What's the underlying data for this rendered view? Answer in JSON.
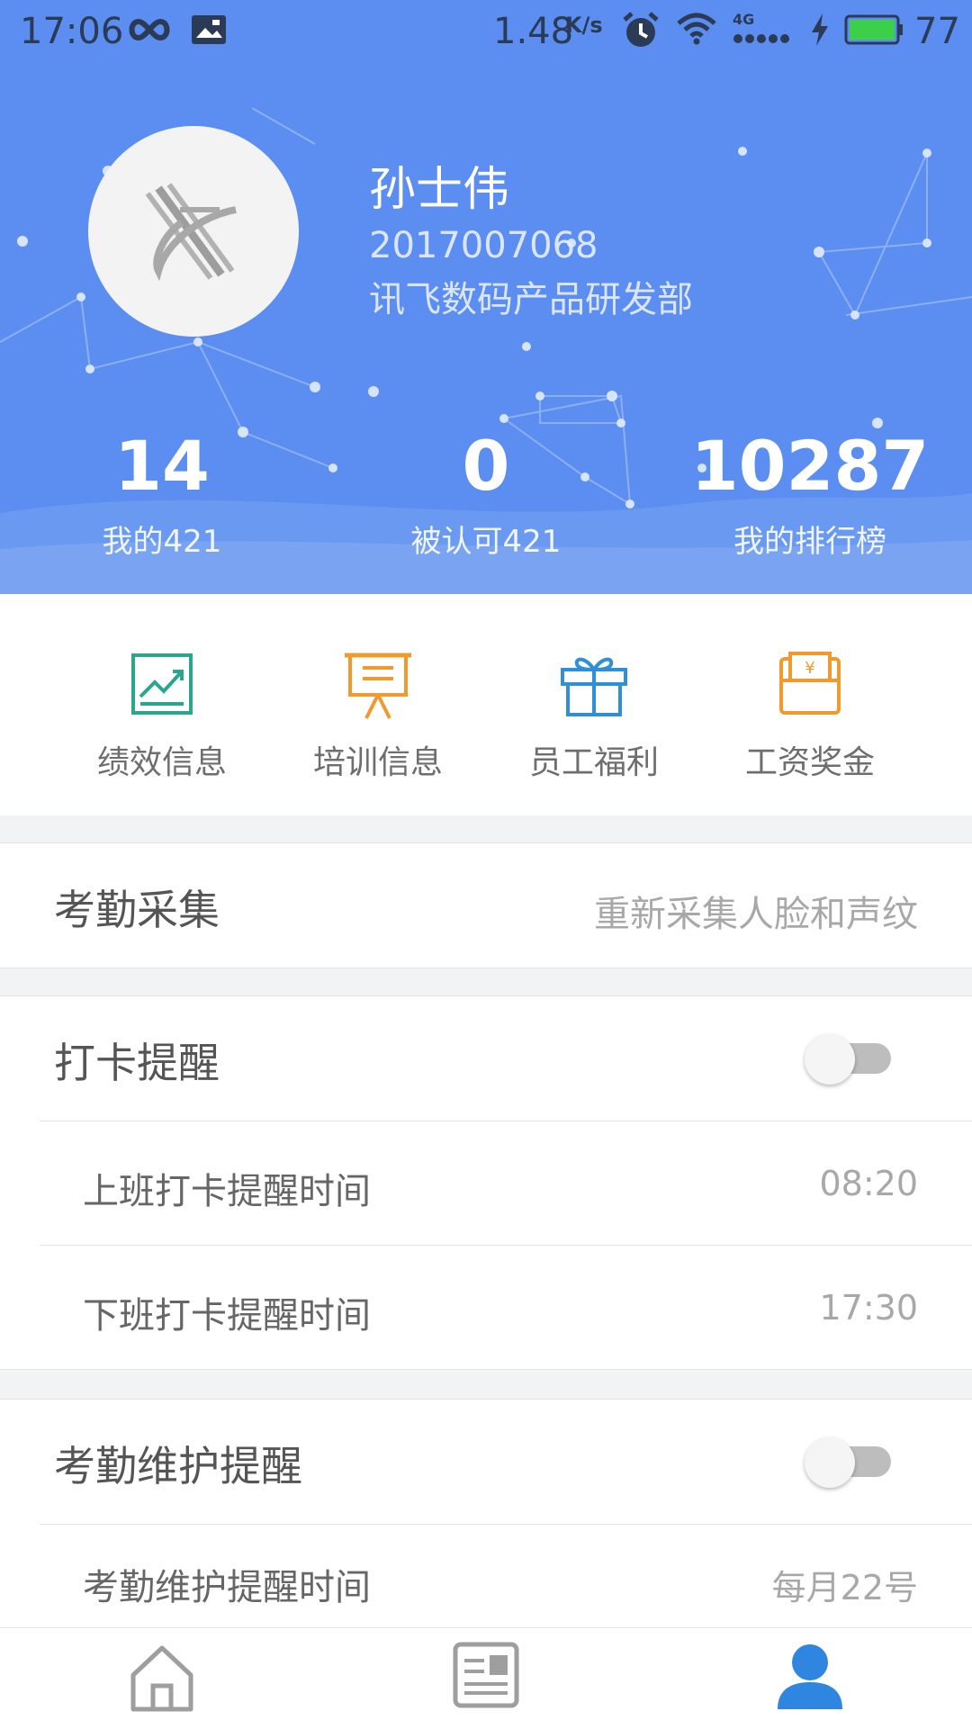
{
  "status_bar": {
    "time": "17:06",
    "network_speed": "1.48",
    "speed_unit": "K/s",
    "network_type": "4G",
    "battery": "77",
    "icons": [
      "infinity-icon",
      "image-icon",
      "alarm-icon",
      "wifi-icon",
      "signal-icon",
      "charging-icon",
      "battery-icon"
    ]
  },
  "profile": {
    "name": "孙士伟",
    "employee_id": "2017007068",
    "department": "讯飞数码产品研发部"
  },
  "stats": [
    {
      "value": "14",
      "label": "我的421"
    },
    {
      "value": "0",
      "label": "被认可421"
    },
    {
      "value": "10287",
      "label": "我的排行榜"
    }
  ],
  "quick_menu": [
    {
      "label": "绩效信息",
      "icon": "chart-icon",
      "color": "#2aa68f"
    },
    {
      "label": "培训信息",
      "icon": "presentation-icon",
      "color": "#f2992e"
    },
    {
      "label": "员工福利",
      "icon": "gift-icon",
      "color": "#2f8fd8"
    },
    {
      "label": "工资奖金",
      "icon": "wallet-icon",
      "color": "#f2992e"
    }
  ],
  "attendance_capture": {
    "title": "考勤采集",
    "action": "重新采集人脸和声纹"
  },
  "clock_reminder": {
    "title": "打卡提醒",
    "enabled": false,
    "on_duty_label": "上班打卡提醒时间",
    "on_duty_time": "08:20",
    "off_duty_label": "下班打卡提醒时间",
    "off_duty_time": "17:30"
  },
  "maintenance_reminder": {
    "title": "考勤维护提醒",
    "enabled": false,
    "time_label": "考勤维护提醒时间",
    "time_value": "每月22号"
  },
  "bottom_nav": [
    {
      "name": "home",
      "icon": "home-icon",
      "active": false
    },
    {
      "name": "news",
      "icon": "news-icon",
      "active": false
    },
    {
      "name": "me",
      "icon": "user-icon",
      "active": true
    }
  ],
  "colors": {
    "header_blue": "#5b8ef0",
    "active_tab": "#2f86e0",
    "inactive_tab": "#9e9e9e"
  }
}
